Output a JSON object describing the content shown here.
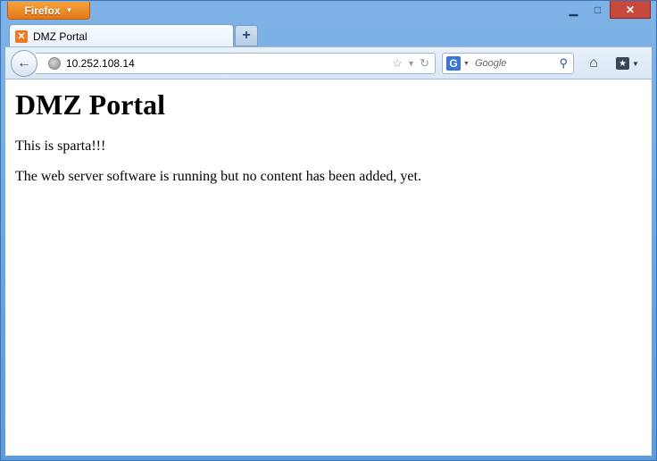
{
  "browser": {
    "app_button_label": "Firefox",
    "window_controls": {
      "minimize": "▁",
      "maximize": "□",
      "close": "✕"
    }
  },
  "tabs": [
    {
      "title": "DMZ Portal",
      "favicon": "xampp-icon"
    }
  ],
  "new_tab_label": "+",
  "navbar": {
    "url": "10.252.108.14",
    "search_placeholder": "Google",
    "search_engine": "G"
  },
  "page": {
    "heading": "DMZ Portal",
    "paragraphs": [
      "This is sparta!!!",
      "The web server software is running but no content has been added, yet."
    ]
  }
}
